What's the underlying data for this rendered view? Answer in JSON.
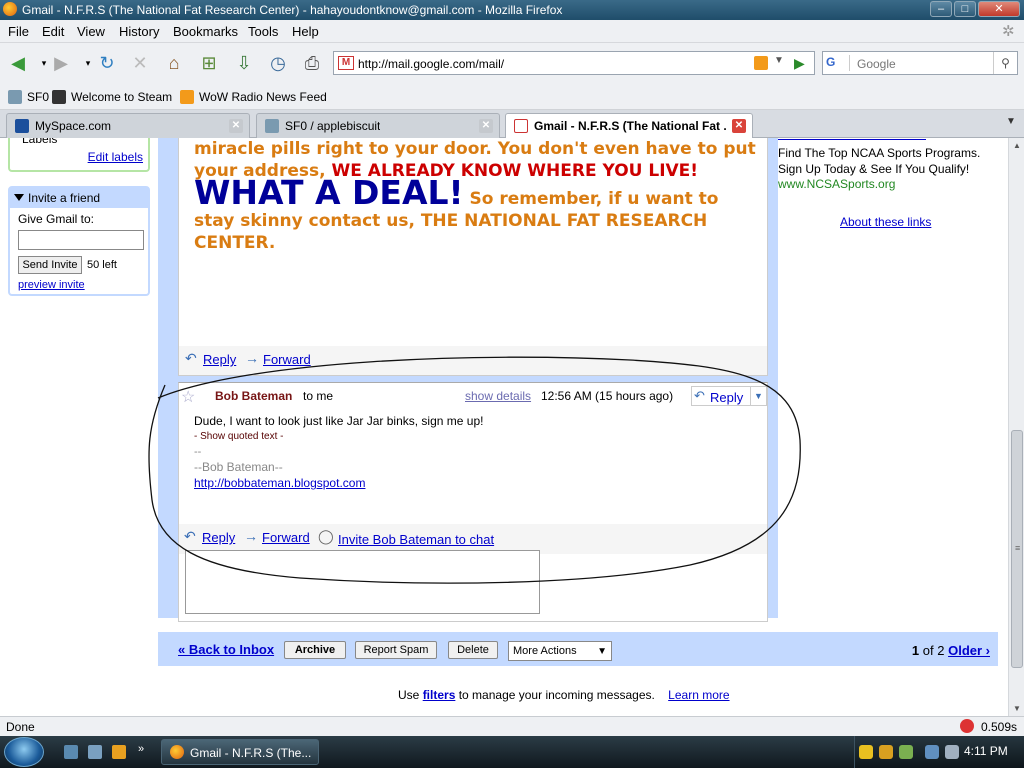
{
  "window": {
    "title": "Gmail - N.F.R.S (The National Fat Research Center) - hahayoudontknow@gmail.com - Mozilla Firefox",
    "btn_min": "–",
    "btn_max": "□",
    "btn_close": "✕"
  },
  "menu": [
    "File",
    "Edit",
    "View",
    "History",
    "Bookmarks",
    "Tools",
    "Help"
  ],
  "address": {
    "url": "http://mail.google.com/mail/",
    "favicon": "M"
  },
  "search": {
    "engine": "G",
    "placeholder": "Google"
  },
  "bookmarks": [
    "SF0",
    "Welcome to Steam",
    "WoW Radio News Feed"
  ],
  "tabs": [
    {
      "label": "MySpace.com",
      "active": false
    },
    {
      "label": "SF0 / applebiscuit",
      "active": false
    },
    {
      "label": "Gmail - N.F.R.S (The National Fat ...",
      "active": true
    }
  ],
  "left_nav": {
    "labels_title": "Labels",
    "edit_labels": "Edit labels",
    "invite_title": "Invite a friend",
    "give_gmail": "Give Gmail to:",
    "send_invite": "Send Invite",
    "invites_left": "50 left",
    "preview_invite": "preview invite"
  },
  "message1": {
    "line1": "miracle pills right to your door. You don't even have to put your address,",
    "red1": "WE ALREADY KNOW WHERE YOU LIVE!",
    "big": "WHAT A DEAL!",
    "line2": "So remember, if u want to stay skinny contact us, THE NATIONAL FAT RESEARCH CENTER.",
    "reply": "Reply",
    "forward": "Forward"
  },
  "message2": {
    "sender": "Bob Bateman",
    "to": "to me",
    "show_details": "show details",
    "time": "12:56 AM (15 hours ago)",
    "reply": "Reply",
    "body": "Dude, I want to look just like Jar Jar binks, sign me up!",
    "show_quoted": "- Show quoted text -",
    "dashes": "--",
    "signature": "--Bob Bateman--",
    "blog": "http://bobbateman.blogspot.com",
    "reply_action": "Reply",
    "forward_action": "Forward",
    "invite_chat": "Invite Bob Bateman to chat"
  },
  "bottom_bar": {
    "back": "« Back to Inbox",
    "archive": "Archive",
    "report_spam": "Report Spam",
    "delete": "Delete",
    "more_actions": "More Actions",
    "page_current": "1",
    "page_of": "of 2",
    "older": "Older ›"
  },
  "filters_note": {
    "prefix": "Use",
    "filters": "filters",
    "suffix": "to manage your incoming messages.",
    "learn_more": "Learn more"
  },
  "ads": {
    "text": "Find The Top NCAA Sports Programs. Sign Up Today & See If You Qualify!",
    "url": "www.NCSASports.org",
    "about": "About these links"
  },
  "status": {
    "text": "Done",
    "timer": "0.509s"
  },
  "taskbar": {
    "task": "Gmail - N.F.R.S (The...",
    "clock": "4:11 PM"
  },
  "colors": {
    "gmail_blue": "#c3d9ff",
    "spam_orange": "#d97c12",
    "spam_red": "#cc0000",
    "spam_blue": "#000099",
    "sender_red": "#771515"
  }
}
